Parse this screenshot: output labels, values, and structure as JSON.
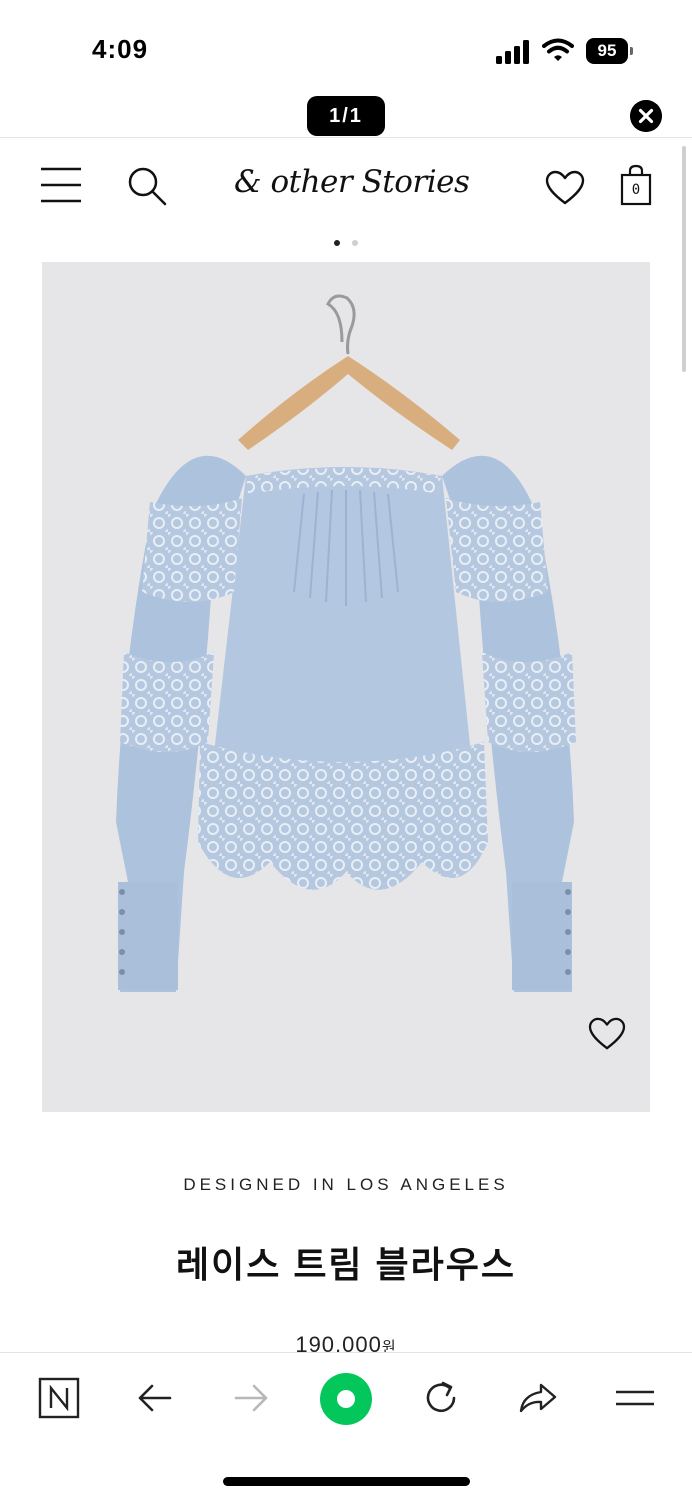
{
  "status_bar": {
    "time": "4:09",
    "battery_level": "95",
    "icons": [
      "signal-icon",
      "wifi-icon",
      "battery-icon"
    ]
  },
  "browser": {
    "url": "st                      m",
    "page_counter": "1/1",
    "close_icon": "close-icon"
  },
  "site_header": {
    "logo": "& other Stories",
    "icons": [
      "menu-icon",
      "search-icon",
      "heart-icon",
      "shopping-bag-icon"
    ],
    "bag_count": "0"
  },
  "carousel": {
    "current_index": 1,
    "total": 2
  },
  "product": {
    "tagline": "DESIGNED IN LOS ANGELES",
    "title": "레이스 트림 블라우스",
    "price": "190,000",
    "price_unit": "원",
    "image_description_icon": "wishlist-heart-icon"
  },
  "toolbar": {
    "items": [
      "naver-n-icon",
      "back-arrow-icon",
      "forward-arrow-icon",
      "home-circle-icon",
      "reload-icon",
      "share-icon",
      "menu-icon"
    ]
  },
  "colors": {
    "accent_green": "#03c75a",
    "image_background": "#e6e6e8",
    "blouse_blue": "#b3c7e0"
  }
}
